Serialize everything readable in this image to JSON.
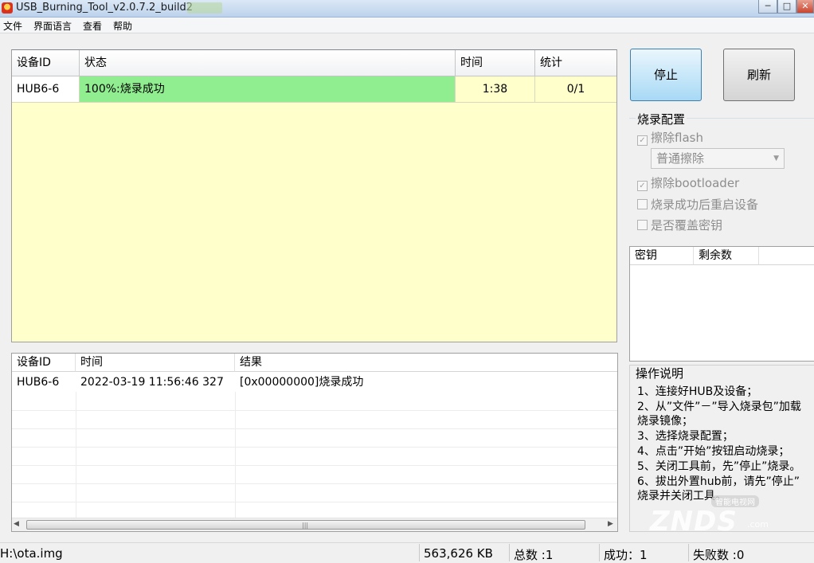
{
  "window": {
    "title": "USB_Burning_Tool_v2.0.7.2_build2",
    "controls": {
      "minimize": "─",
      "maximize": "□",
      "close": "✕"
    }
  },
  "menu": [
    "文件",
    "界面语言",
    "查看",
    "帮助"
  ],
  "device_table": {
    "headers": [
      "设备ID",
      "状态",
      "时间",
      "统计"
    ],
    "rows": [
      {
        "id": "HUB6-6",
        "status": "100%:烧录成功",
        "time": "1:38",
        "stats": "0/1",
        "progress": 1.0
      }
    ]
  },
  "buttons": {
    "stop": "停止",
    "refresh": "刷新"
  },
  "config": {
    "group_title": "烧录配置",
    "erase_flash": "擦除flash",
    "erase_mode": "普通擦除",
    "erase_bootloader": "擦除bootloader",
    "reboot_after": "烧录成功后重启设备",
    "overwrite_key": "是否覆盖密钥"
  },
  "key_table": {
    "headers": [
      "密钥",
      "剩余数"
    ]
  },
  "log_table": {
    "headers": [
      "设备ID",
      "时间",
      "结果"
    ],
    "rows": [
      {
        "id": "HUB6-6",
        "time": "2022-03-19 11:56:46 327",
        "result": "[0x00000000]烧录成功"
      }
    ]
  },
  "instructions": {
    "title": "操作说明",
    "lines": [
      "1、连接好HUB及设备；",
      "2、从”文件”－”导入烧录包”加载",
      "烧录镜像；",
      "3、选择烧录配置；",
      "4、点击”开始”按钮启动烧录；",
      "5、关闭工具前，先”停止”烧录。",
      "6、拔出外置hub前，请先”停止”",
      "烧录并关闭工具。"
    ]
  },
  "status_bar": {
    "path": "H:\\ota.img",
    "size": "563,626 KB",
    "total": "总数 :1",
    "success": "成功：1",
    "failed": "失败数 :0"
  },
  "watermark": {
    "text": "ZNDS",
    "sub": ".com",
    "badge": "智能电视网"
  },
  "colors": {
    "success_green": "#90ee90",
    "panel_yellow": "#ffffcc"
  }
}
